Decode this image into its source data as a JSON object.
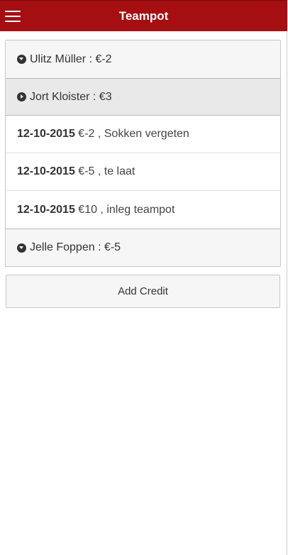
{
  "header": {
    "title": "Teampot",
    "color": "#a50f12"
  },
  "menu": {
    "icon": "hamburger-menu-icon"
  },
  "members": [
    {
      "label": "Ulitz Müller : €-2",
      "state": "collapsed"
    },
    {
      "label": "Jort Kloister : €3",
      "state": "expanded"
    },
    {
      "label": "Jelle Foppen : €-5",
      "state": "collapsed"
    }
  ],
  "entries": [
    {
      "date": "12-10-2015",
      "text": " €-2 , Sokken vergeten"
    },
    {
      "date": "12-10-2015",
      "text": " €-5 , te laat"
    },
    {
      "date": "12-10-2015",
      "text": " €10 , inleg teampot"
    }
  ],
  "actions": {
    "add_credit_label": "Add Credit"
  }
}
